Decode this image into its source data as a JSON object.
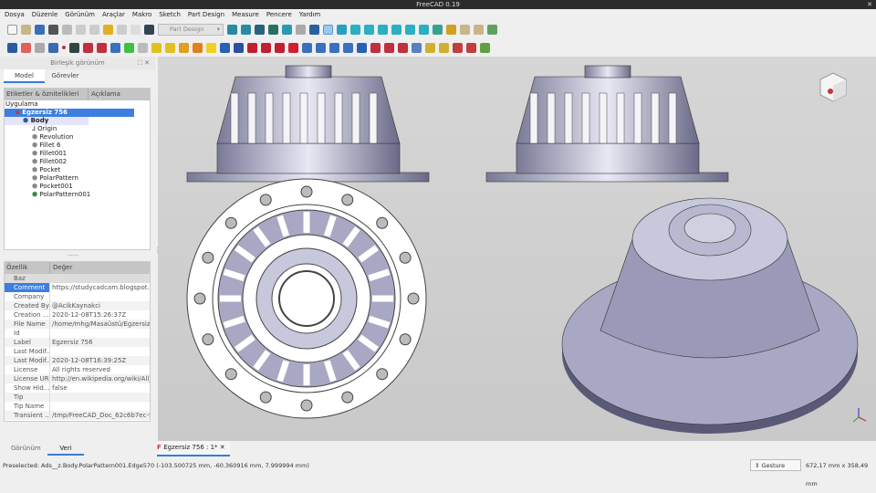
{
  "window": {
    "title": "FreeCAD 0.19"
  },
  "menu": [
    "Dosya",
    "Düzenle",
    "Görünüm",
    "Araçlar",
    "Makro",
    "Sketch",
    "Part Design",
    "Measure",
    "Pencere",
    "Yardım"
  ],
  "toolbar": {
    "workbench": "Part Design"
  },
  "combo_view": {
    "title": "Birleşik görünüm",
    "tabs": [
      "Model",
      "Görevler"
    ],
    "tree_headers": [
      "Etiketler & öznitelikleri",
      "Açıklama"
    ],
    "root_label": "Uygulama",
    "items": [
      {
        "label": "Egzersiz 756",
        "level": 0
      },
      {
        "label": "Body",
        "level": 1
      },
      {
        "label": "Origin",
        "level": 2
      },
      {
        "label": "Revolution",
        "level": 2
      },
      {
        "label": "Fillet 6",
        "level": 2
      },
      {
        "label": "Fillet001",
        "level": 2
      },
      {
        "label": "Fillet002",
        "level": 2
      },
      {
        "label": "Pocket",
        "level": 2
      },
      {
        "label": "PolarPattern",
        "level": 2
      },
      {
        "label": "Pocket001",
        "level": 2
      },
      {
        "label": "PolarPattern001",
        "level": 2
      }
    ]
  },
  "properties": {
    "headers": [
      "Özellik",
      "Değer"
    ],
    "group": "Baz",
    "rows": [
      {
        "k": "Comment",
        "v": "https://studycadcam.blogspot.com"
      },
      {
        "k": "Company",
        "v": ""
      },
      {
        "k": "Created By",
        "v": "@AcikKaynakci"
      },
      {
        "k": "Creation ...",
        "v": "2020-12-08T15:26:37Z"
      },
      {
        "k": "File Name",
        "v": "/home/mhg/Masaüstü/Egzersiz 7..."
      },
      {
        "k": "Id",
        "v": ""
      },
      {
        "k": "Label",
        "v": "Egzersiz 756"
      },
      {
        "k": "Last Modif...",
        "v": ""
      },
      {
        "k": "Last Modif...",
        "v": "2020-12-08T16:39:25Z"
      },
      {
        "k": "License",
        "v": "All rights reserved"
      },
      {
        "k": "License URL",
        "v": "http://en.wikipedia.org/wiki/All_ri..."
      },
      {
        "k": "Show Hid...",
        "v": "false"
      },
      {
        "k": "Tip",
        "v": ""
      },
      {
        "k": "Tip Name",
        "v": ""
      },
      {
        "k": "Transient ...",
        "v": "/tmp/FreeCAD_Doc_62c6b7ec-94..."
      }
    ]
  },
  "bottom_tabs": [
    "Görünüm",
    "Veri"
  ],
  "document_tab": "Egzersiz 756 : 1*",
  "status": {
    "message": "Preselected: Ads__z.Body.PolarPattern001.Edge570 (-103.500725 mm, -60.360916 mm, 7.999994 mm)",
    "nav_style": "Gesture",
    "dimensions": "672,17 mm x 358,49 mm"
  },
  "colors": {
    "selection": "#3d7fe0",
    "part": "#a8a8c4"
  }
}
